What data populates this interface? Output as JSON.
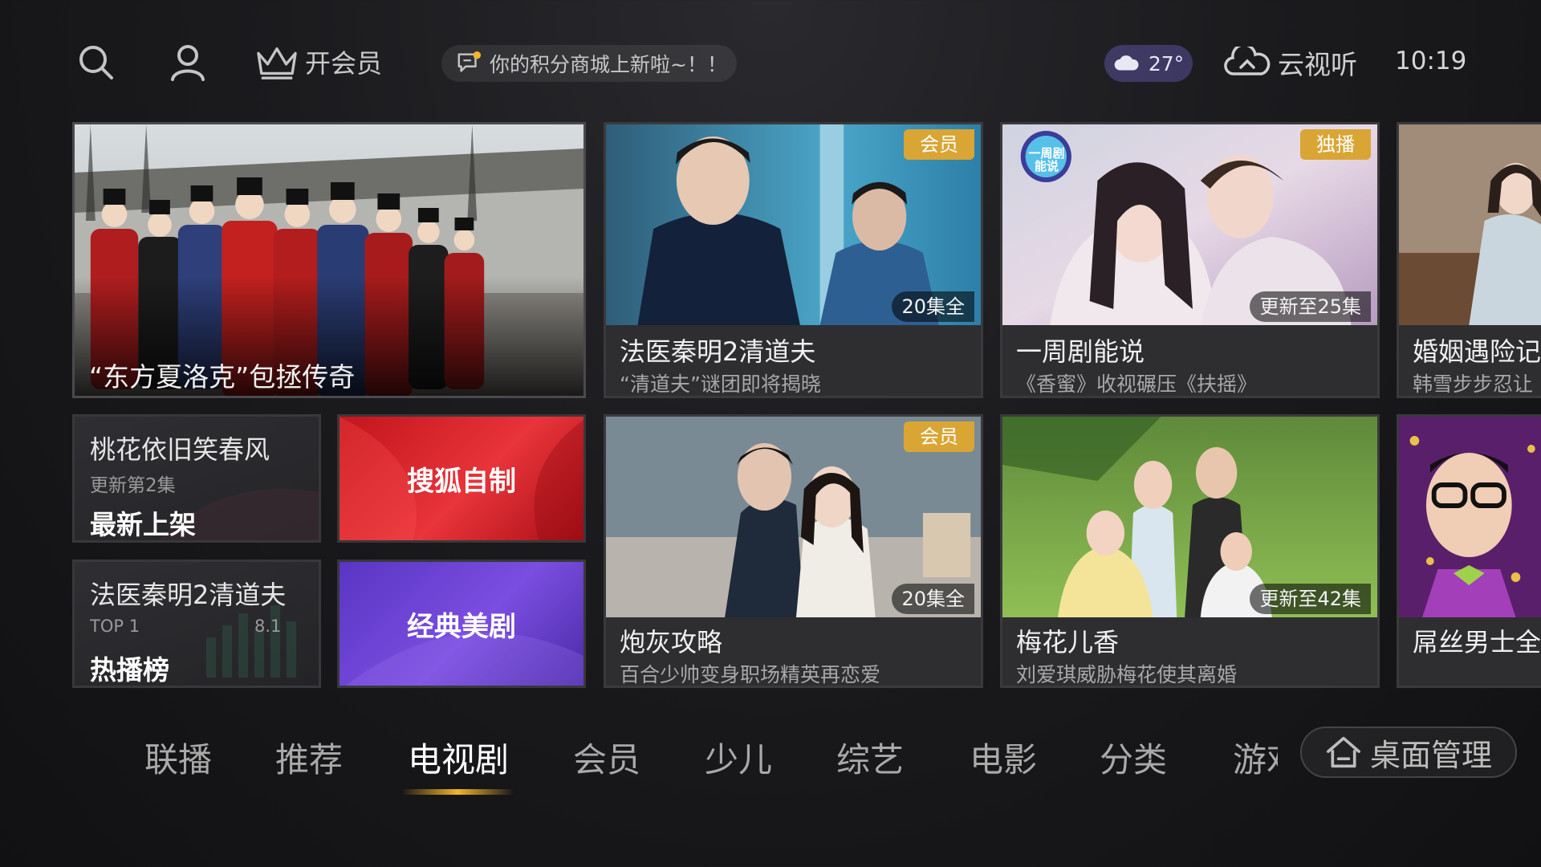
{
  "topbar": {
    "vip_label": "开会员",
    "notice_text": "你的积分商城上新啦~！！",
    "temperature": "27°",
    "brand": "云视听",
    "time": "10:19"
  },
  "cards": {
    "hero": {
      "title": "“东方夏洛克”包拯传奇"
    },
    "forensic": {
      "tag": "会员",
      "episodes": "20集全",
      "title": "法医秦明2清道夫",
      "subtitle": "“清道夫”谜团即将揭晓"
    },
    "weekly": {
      "tag": "独播",
      "logo": "一周剧能说",
      "episodes": "更新至25集",
      "title": "一周剧能说",
      "subtitle": "《香蜜》收视碾压《扶摇》"
    },
    "marriage": {
      "title": "婚姻遇险记",
      "subtitle": "韩雪步步忍让"
    },
    "newest": {
      "show": "桃花依旧笑春风",
      "update": "更新第2集",
      "label": "最新上架"
    },
    "sohu": {
      "label": "搜狐自制"
    },
    "hot": {
      "show": "法医秦明2清道夫",
      "rank": "TOP 1",
      "score": "8.1",
      "label": "热播榜"
    },
    "classic": {
      "label": "经典美剧"
    },
    "cannon": {
      "tag": "会员",
      "episodes": "20集全",
      "title": "炮灰攻略",
      "subtitle": "百合少帅变身职场精英再恋爱"
    },
    "plum": {
      "episodes": "更新至42集",
      "title": "梅花儿香",
      "subtitle": "刘爱琪威胁梅花使其离婚"
    },
    "loser": {
      "title": "屌丝男士全"
    }
  },
  "nav": {
    "items": [
      "联播",
      "推荐",
      "电视剧",
      "会员",
      "少儿",
      "综艺",
      "电影",
      "分类",
      "游戏"
    ],
    "active": "电视剧",
    "desktop_button": "桌面管理"
  },
  "colors": {
    "accent": "#f5b428",
    "tag": "#d9a534",
    "sohu_red": "#d9252c",
    "classic_purple": "#6a3fd0"
  }
}
